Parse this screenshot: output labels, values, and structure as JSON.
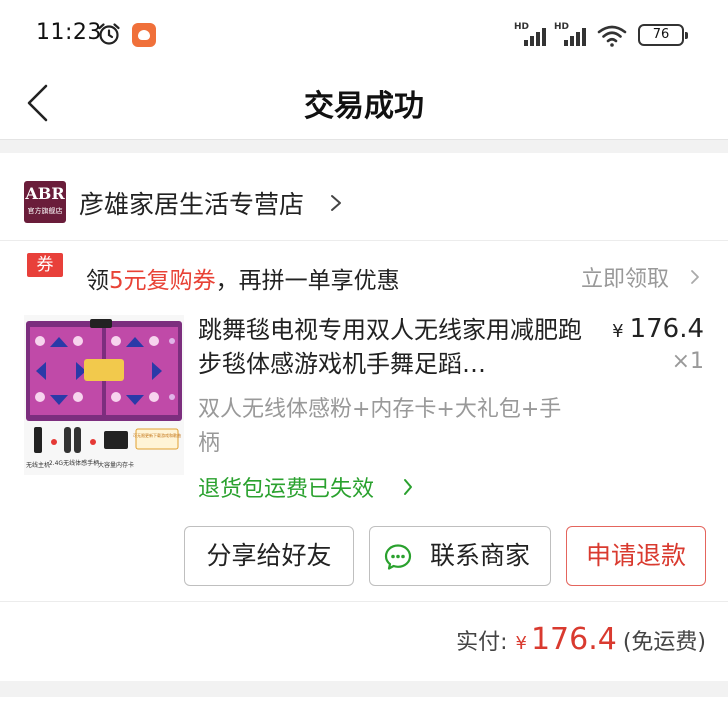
{
  "status_bar": {
    "time": "11:23",
    "battery": "76",
    "signal_label_1": "HD",
    "signal_label_2": "HD"
  },
  "nav": {
    "title": "交易成功"
  },
  "shop": {
    "logo_text": "ABR",
    "logo_subtext": "官方旗舰店",
    "name": "彦雄家居生活专营店"
  },
  "coupon": {
    "tag": "券",
    "text_prefix": "领",
    "text_highlight": "5元复购券",
    "text_suffix": "，再拼一单享优惠",
    "claim": "立即领取"
  },
  "product": {
    "title": "跳舞毯电视专用双人无线家用减肥跑步毯体感游戏机手舞足蹈…",
    "price_symbol": "¥",
    "price": "176.4",
    "quantity": "×1",
    "spec": "双人无线体感粉+内存卡+大礼包+手柄",
    "return_notice": "退货包运费已失效",
    "image_labels": {
      "host": "无线主机",
      "handle": "2.4G无线体感手柄",
      "card": "大容量内存卡",
      "promo": "可无限更新下载游戏和歌曲"
    }
  },
  "actions": {
    "share": "分享给好友",
    "contact": "联系商家",
    "refund": "申请退款"
  },
  "total": {
    "label": "实付:",
    "symbol": "¥",
    "amount": "176.4",
    "note": "(免运费)"
  },
  "colors": {
    "accent_red": "#d93a2f",
    "green": "#2aa12e",
    "shop_logo_bg": "#6a1d3a"
  }
}
